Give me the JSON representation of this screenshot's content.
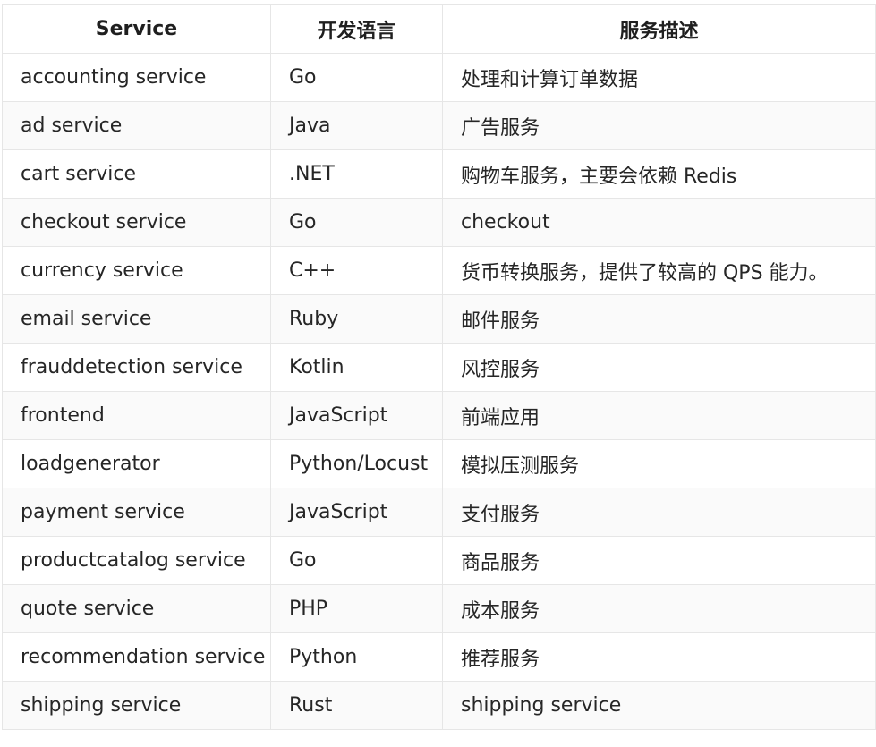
{
  "table": {
    "headers": [
      "Service",
      "开发语言",
      "服务描述"
    ],
    "rows": [
      [
        "accounting service",
        "Go",
        "处理和计算订单数据"
      ],
      [
        "ad service",
        "Java",
        "广告服务"
      ],
      [
        "cart service",
        ".NET",
        "购物车服务，主要会依赖 Redis"
      ],
      [
        "checkout service",
        "Go",
        "checkout"
      ],
      [
        "currency service",
        "C++",
        "货币转换服务，提供了较高的 QPS 能力。"
      ],
      [
        "email service",
        "Ruby",
        "邮件服务"
      ],
      [
        "frauddetection service",
        "Kotlin",
        "风控服务"
      ],
      [
        "frontend",
        "JavaScript",
        "前端应用"
      ],
      [
        "loadgenerator",
        "Python/Locust",
        "模拟压测服务"
      ],
      [
        "payment service",
        "JavaScript",
        "支付服务"
      ],
      [
        "productcatalog service",
        "Go",
        "商品服务"
      ],
      [
        "quote service",
        "PHP",
        "成本服务"
      ],
      [
        "recommendation service",
        "Python",
        "推荐服务"
      ],
      [
        "shipping service",
        "Rust",
        "shipping service"
      ]
    ]
  }
}
